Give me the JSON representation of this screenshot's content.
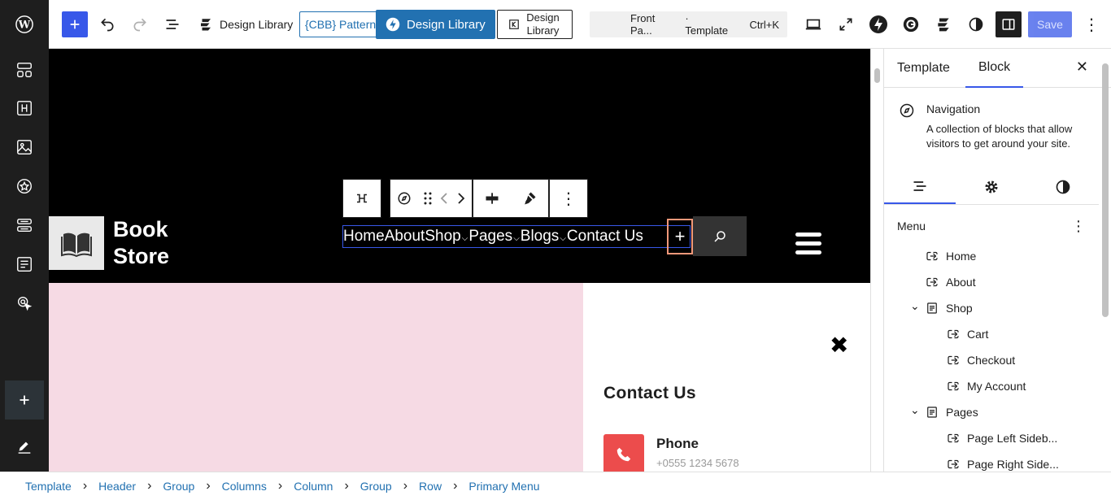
{
  "toolbar": {
    "design_library_1": "Design Library",
    "pattern_button": "{CBB} Pattern",
    "design_library_2": "Design Library",
    "design_library_3": "Design Library",
    "command_bar_title": "Front Pa...",
    "command_bar_type": "· Template",
    "command_bar_shortcut": "Ctrl+K",
    "save_label": "Save"
  },
  "canvas": {
    "logo_line1": "Book",
    "logo_line2": "Store",
    "nav": [
      {
        "label": "Home",
        "dropdown": false
      },
      {
        "label": "About",
        "dropdown": false
      },
      {
        "label": "Shop",
        "dropdown": true
      },
      {
        "label": "Pages",
        "dropdown": true
      },
      {
        "label": "Blogs",
        "dropdown": true
      },
      {
        "label": "Contact Us",
        "dropdown": false
      }
    ],
    "contact_title": "Contact Us",
    "phone_label": "Phone",
    "phone_number": "+0555 1234 5678"
  },
  "panel": {
    "tabs": [
      "Template",
      "Block"
    ],
    "active_tab": "Block",
    "block_name": "Navigation",
    "block_description": "A collection of blocks that allow visitors to get around your site.",
    "menu_heading": "Menu",
    "menu_items": [
      {
        "label": "Home",
        "level": 0,
        "type": "link",
        "expanded": null
      },
      {
        "label": "About",
        "level": 0,
        "type": "link",
        "expanded": null
      },
      {
        "label": "Shop",
        "level": 0,
        "type": "page",
        "expanded": true
      },
      {
        "label": "Cart",
        "level": 1,
        "type": "link",
        "expanded": null
      },
      {
        "label": "Checkout",
        "level": 1,
        "type": "link",
        "expanded": null
      },
      {
        "label": "My Account",
        "level": 1,
        "type": "link",
        "expanded": null
      },
      {
        "label": "Pages",
        "level": 0,
        "type": "page",
        "expanded": true
      },
      {
        "label": "Page Left Sideb...",
        "level": 1,
        "type": "link",
        "expanded": null
      },
      {
        "label": "Page Right Side...",
        "level": 1,
        "type": "link",
        "expanded": null
      }
    ]
  },
  "breadcrumb": [
    "Template",
    "Header",
    "Group",
    "Columns",
    "Column",
    "Group",
    "Row",
    "Primary Menu"
  ],
  "colors": {
    "accent": "#3858e9",
    "link": "#2271b1",
    "header_bg": "#000000",
    "pink_bg": "#f6dae4",
    "phone_icon_bg": "#ec4c4c",
    "highlight_border": "#f2987a"
  }
}
